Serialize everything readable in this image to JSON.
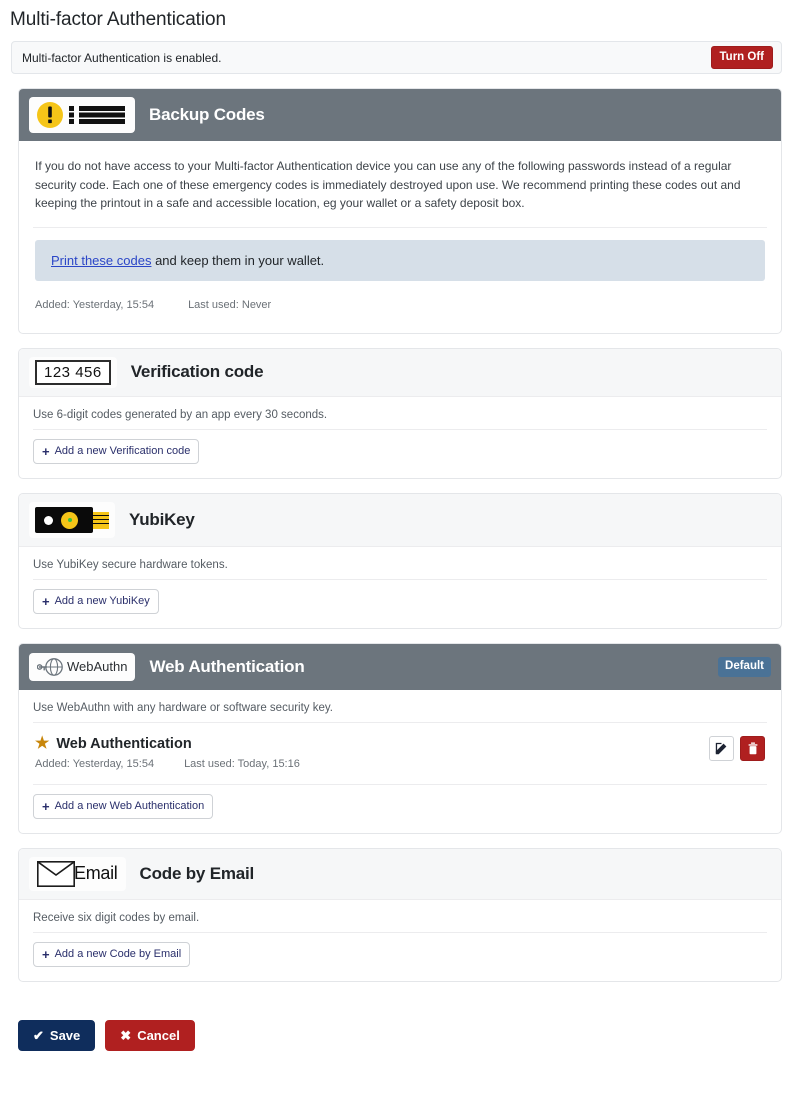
{
  "page": {
    "title": "Multi-factor Authentication"
  },
  "status": {
    "message": "Multi-factor Authentication is enabled.",
    "button_label": "Turn Off",
    "button_color": "#b02020"
  },
  "backup_codes": {
    "icon": "backup-codes-icon",
    "title": "Backup Codes",
    "header_color": "#6c757d",
    "paragraph": "If you do not have access to your Multi-factor Authentication device you can use any of the following passwords instead of a regular security code. Each one of these emergency codes is immediately destroyed upon use. We recommend printing these codes out and keeping the printout in a safe and accessible location, eg your wallet or a safety deposit box.",
    "info_link": "Print these codes",
    "info_rest": " and keep them in your wallet.",
    "info_bg": "#d6dfe8",
    "added": "Added: Yesterday, 15:54",
    "last_used": "Last used: Never"
  },
  "verification_code": {
    "icon": "verification-code-icon",
    "icon_text": "123 456",
    "title": "Verification code",
    "description": "Use 6-digit codes generated by an app every 30 seconds.",
    "add_label": "Add a new Verification code"
  },
  "yubikey": {
    "icon": "yubikey-icon",
    "title": "YubiKey",
    "description": "Use YubiKey secure hardware tokens.",
    "add_label": "Add a new YubiKey"
  },
  "web_authentication": {
    "icon": "webauthn-icon",
    "icon_text": "WebAuthn",
    "title": "Web Authentication",
    "badge": "Default",
    "badge_color": "#4a7296",
    "header_color": "#6c757d",
    "description": "Use WebAuthn with any hardware or software security key.",
    "add_label": "Add a new Web Authentication",
    "keys": [
      {
        "name": "Web Authentication",
        "starred": true,
        "added": "Added: Yesterday, 15:54",
        "last_used": "Last used: Today, 15:16",
        "edit_label": "edit-icon",
        "delete_label": "trash-icon"
      }
    ]
  },
  "code_by_email": {
    "icon": "email-icon",
    "icon_text": "Email",
    "title": "Code by Email",
    "description": "Receive six digit codes by email.",
    "add_label": "Add a new Code by Email"
  },
  "footer": {
    "save_label": "Save",
    "cancel_label": "Cancel",
    "save_color": "#0f2d5c",
    "cancel_color": "#b02020"
  }
}
